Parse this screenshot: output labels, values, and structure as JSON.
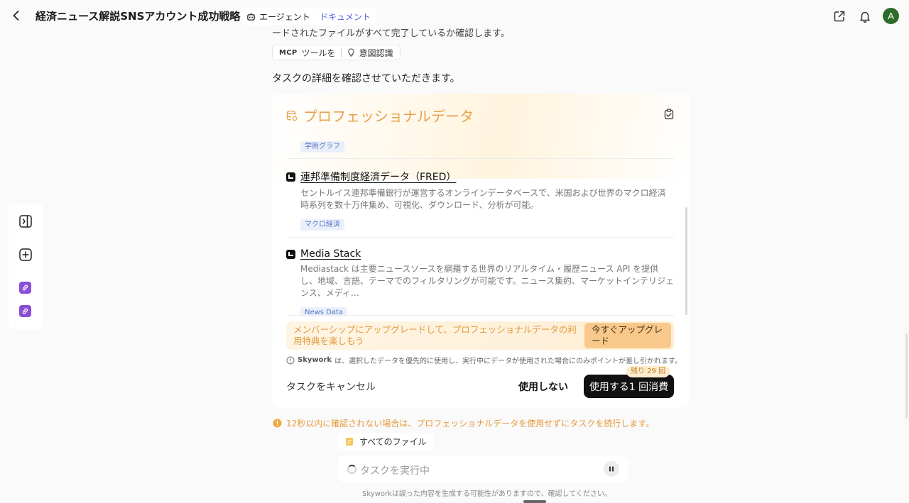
{
  "header": {
    "title": "経済ニュース解説SNSアカウント成功戦略",
    "agent_label": "エージェント",
    "agent_separator": "·",
    "doc_label": "ドキュメント",
    "avatar_initial": "A"
  },
  "chat": {
    "prev_line": "ードされたファイルがすべて完了しているか確認します。",
    "tool_chip": {
      "mcp": "MCP",
      "tool_label": "ツールを",
      "intent_label": "意図認識"
    },
    "confirm_text": "タスクの詳細を確認させていただきます。"
  },
  "card": {
    "title": "プロフェッショナルデータ",
    "first_tag": "学術グラフ",
    "datasets": [
      {
        "name": "連邦準備制度経済データ（FRED）",
        "description": "セントルイス連邦準備銀行が運営するオンラインデータベースで、米国および世界のマクロ経済時系列を数十万件集め、可視化、ダウンロード、分析が可能。",
        "tag": "マクロ経済"
      },
      {
        "name": "Media Stack",
        "description": "Mediastack は主要ニュースソースを網羅する世界のリアルタイム・履歴ニュース API を提供し、地域、言語、テーマでのフィルタリングが可能です。ニュース集約、マーケットインテリジェンス、メディ…",
        "tag": "News Data"
      }
    ],
    "upgrade": {
      "text": "メンバーシップにアップグレードして、プロフェッショナルデータの利用特典を楽しもう",
      "button": "今すぐアップグレード"
    },
    "notice": {
      "brand": "Skywork",
      "text": "は、選択したデータを優先的に使用し、実行中にデータが使用された場合にのみポイントが差し引かれます。"
    },
    "cancel_label": "タスクをキャンセル",
    "no_use_label": "使用しない",
    "use_label": "使用する1 回消費",
    "remaining_badge": "残り 29 回"
  },
  "timeout_text": "12秒以内に確認されない場合は、プロフェッショナルデータを使用せずにタスクを続行します。",
  "files_label": "すべてのファイル",
  "task_input": {
    "status": "タスクを実行中"
  },
  "disclaimer": "Skyworkは誤った内容を生成する可能性がありますので、確認してください。",
  "colors": {
    "accent_orange": "#e7a04a",
    "link_purple": "#8a4dd6",
    "doc_link": "#5560e8",
    "avatar_green": "#2f6b2b",
    "primary_button": "#111111"
  },
  "icons": {
    "back": "chevron-left-icon",
    "agent": "robot-icon",
    "share": "share-icon",
    "bell": "bell-icon",
    "sidebar_toggle": "sidebar-toggle-icon",
    "new_chat": "plus-square-icon",
    "link": "link-icon",
    "database": "database-icon",
    "copy": "clipboard-icon",
    "bulb": "lightbulb-icon",
    "info": "info-icon",
    "warning": "warning-circle-icon",
    "file": "file-icon",
    "pause": "pause-icon"
  }
}
